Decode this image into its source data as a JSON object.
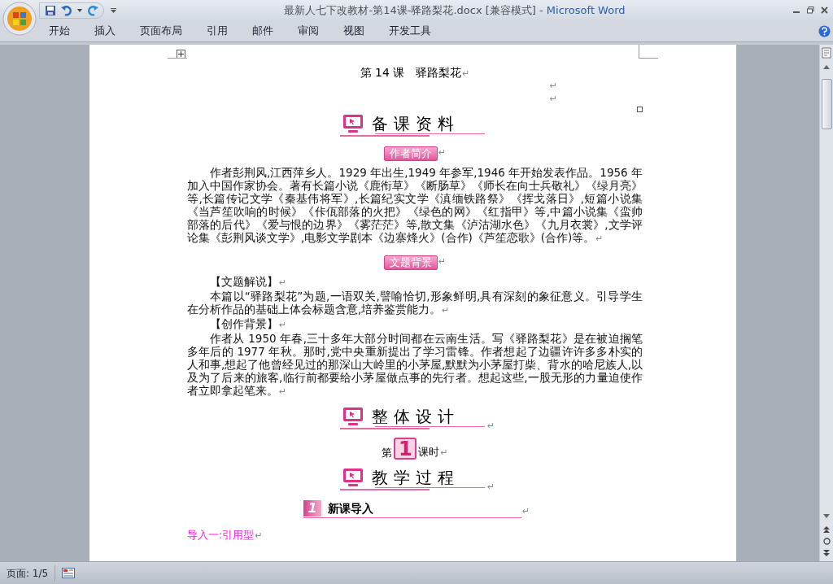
{
  "window": {
    "title": "最新人七下改教材-第14课-驿路梨花.docx [兼容模式]",
    "app_name": " - Microsoft Word"
  },
  "ribbon_tabs": [
    {
      "label": "开始",
      "selected": false
    },
    {
      "label": "插入",
      "selected": false
    },
    {
      "label": "页面布局",
      "selected": false
    },
    {
      "label": "引用",
      "selected": false
    },
    {
      "label": "邮件",
      "selected": false
    },
    {
      "label": "审阅",
      "selected": false
    },
    {
      "label": "视图",
      "selected": false
    },
    {
      "label": "开发工具",
      "selected": false
    }
  ],
  "document": {
    "blocks": [
      {
        "kind": "title",
        "text": "第 14 课　驿路梨花",
        "end_mark": "↵"
      },
      {
        "kind": "blank",
        "end_mark": "↵"
      },
      {
        "kind": "blank",
        "end_mark": "↵"
      },
      {
        "kind": "section",
        "text": "备课资料"
      },
      {
        "kind": "label",
        "text": "作者简介",
        "end_mark": "↵"
      },
      {
        "kind": "paragraph",
        "text": "作者彭荆风,江西萍乡人。1929 年出生,1949 年参军,1946 年开始发表作品。1956 年加入中国作家协会。著有长篇小说《鹿衔草》《断肠草》《师长在向士兵敬礼》《绿月亮》等,长篇传记文学《秦基伟将军》,长篇纪实文学《滇缅铁路祭》《挥戈落日》,短篇小说集《当芦笙吹响的时候》《佧佤部落的火把》《绿色的网》《红指甲》等,中篇小说集《蛮帅部落的后代》《爱与恨的边界》《雾茫茫》等,散文集《泸沽湖水色》《九月衣裳》,文学评论集《彭荆风谈文学》,电影文学剧本《边寨烽火》(合作)《芦笙恋歌》(合作)等。",
        "end_mark": "↵"
      },
      {
        "kind": "label",
        "text": "文题背景",
        "end_mark": "↵"
      },
      {
        "kind": "paragraph",
        "text": "【文题解说】",
        "end_mark": "↵"
      },
      {
        "kind": "paragraph",
        "text": "本篇以“驿路梨花”为题,一语双关,譬喻恰切,形象鲜明,具有深刻的象征意义。引导学生在分析作品的基础上体会标题含意,培养鉴赏能力。",
        "end_mark": "↵"
      },
      {
        "kind": "paragraph",
        "text": "【创作背景】",
        "end_mark": "↵"
      },
      {
        "kind": "paragraph",
        "text": "作者从 1950 年春,三十多年大部分时间都在云南生活。写《驿路梨花》是在被迫搁笔多年后的 1977 年秋。那时,党中央重新提出了学习雷锋。作者想起了边疆许许多多朴实的人和事,想起了他曾经见过的那深山大岭里的小茅屋,默默为小茅屋打柴、背水的哈尼族人,以及为了后来的旅客,临行前都要给小茅屋做点事的先行者。想起这些,一股无形的力量迫使作者立即拿起笔来。",
        "end_mark": "↵"
      },
      {
        "kind": "section",
        "text": "整体设计",
        "end_mark": "↵"
      },
      {
        "kind": "lesson",
        "prefix": "第",
        "number": "1",
        "suffix": "课时",
        "end_mark": "↵"
      },
      {
        "kind": "section",
        "text": "教学过程",
        "end_mark": "↵"
      },
      {
        "kind": "step",
        "number": "1",
        "text": "新课导入",
        "end_mark": "↵"
      },
      {
        "kind": "lead",
        "text": "导入一:引用型",
        "end_mark": "↵"
      }
    ]
  },
  "status_bar": {
    "page": "页面: 1/5"
  }
}
